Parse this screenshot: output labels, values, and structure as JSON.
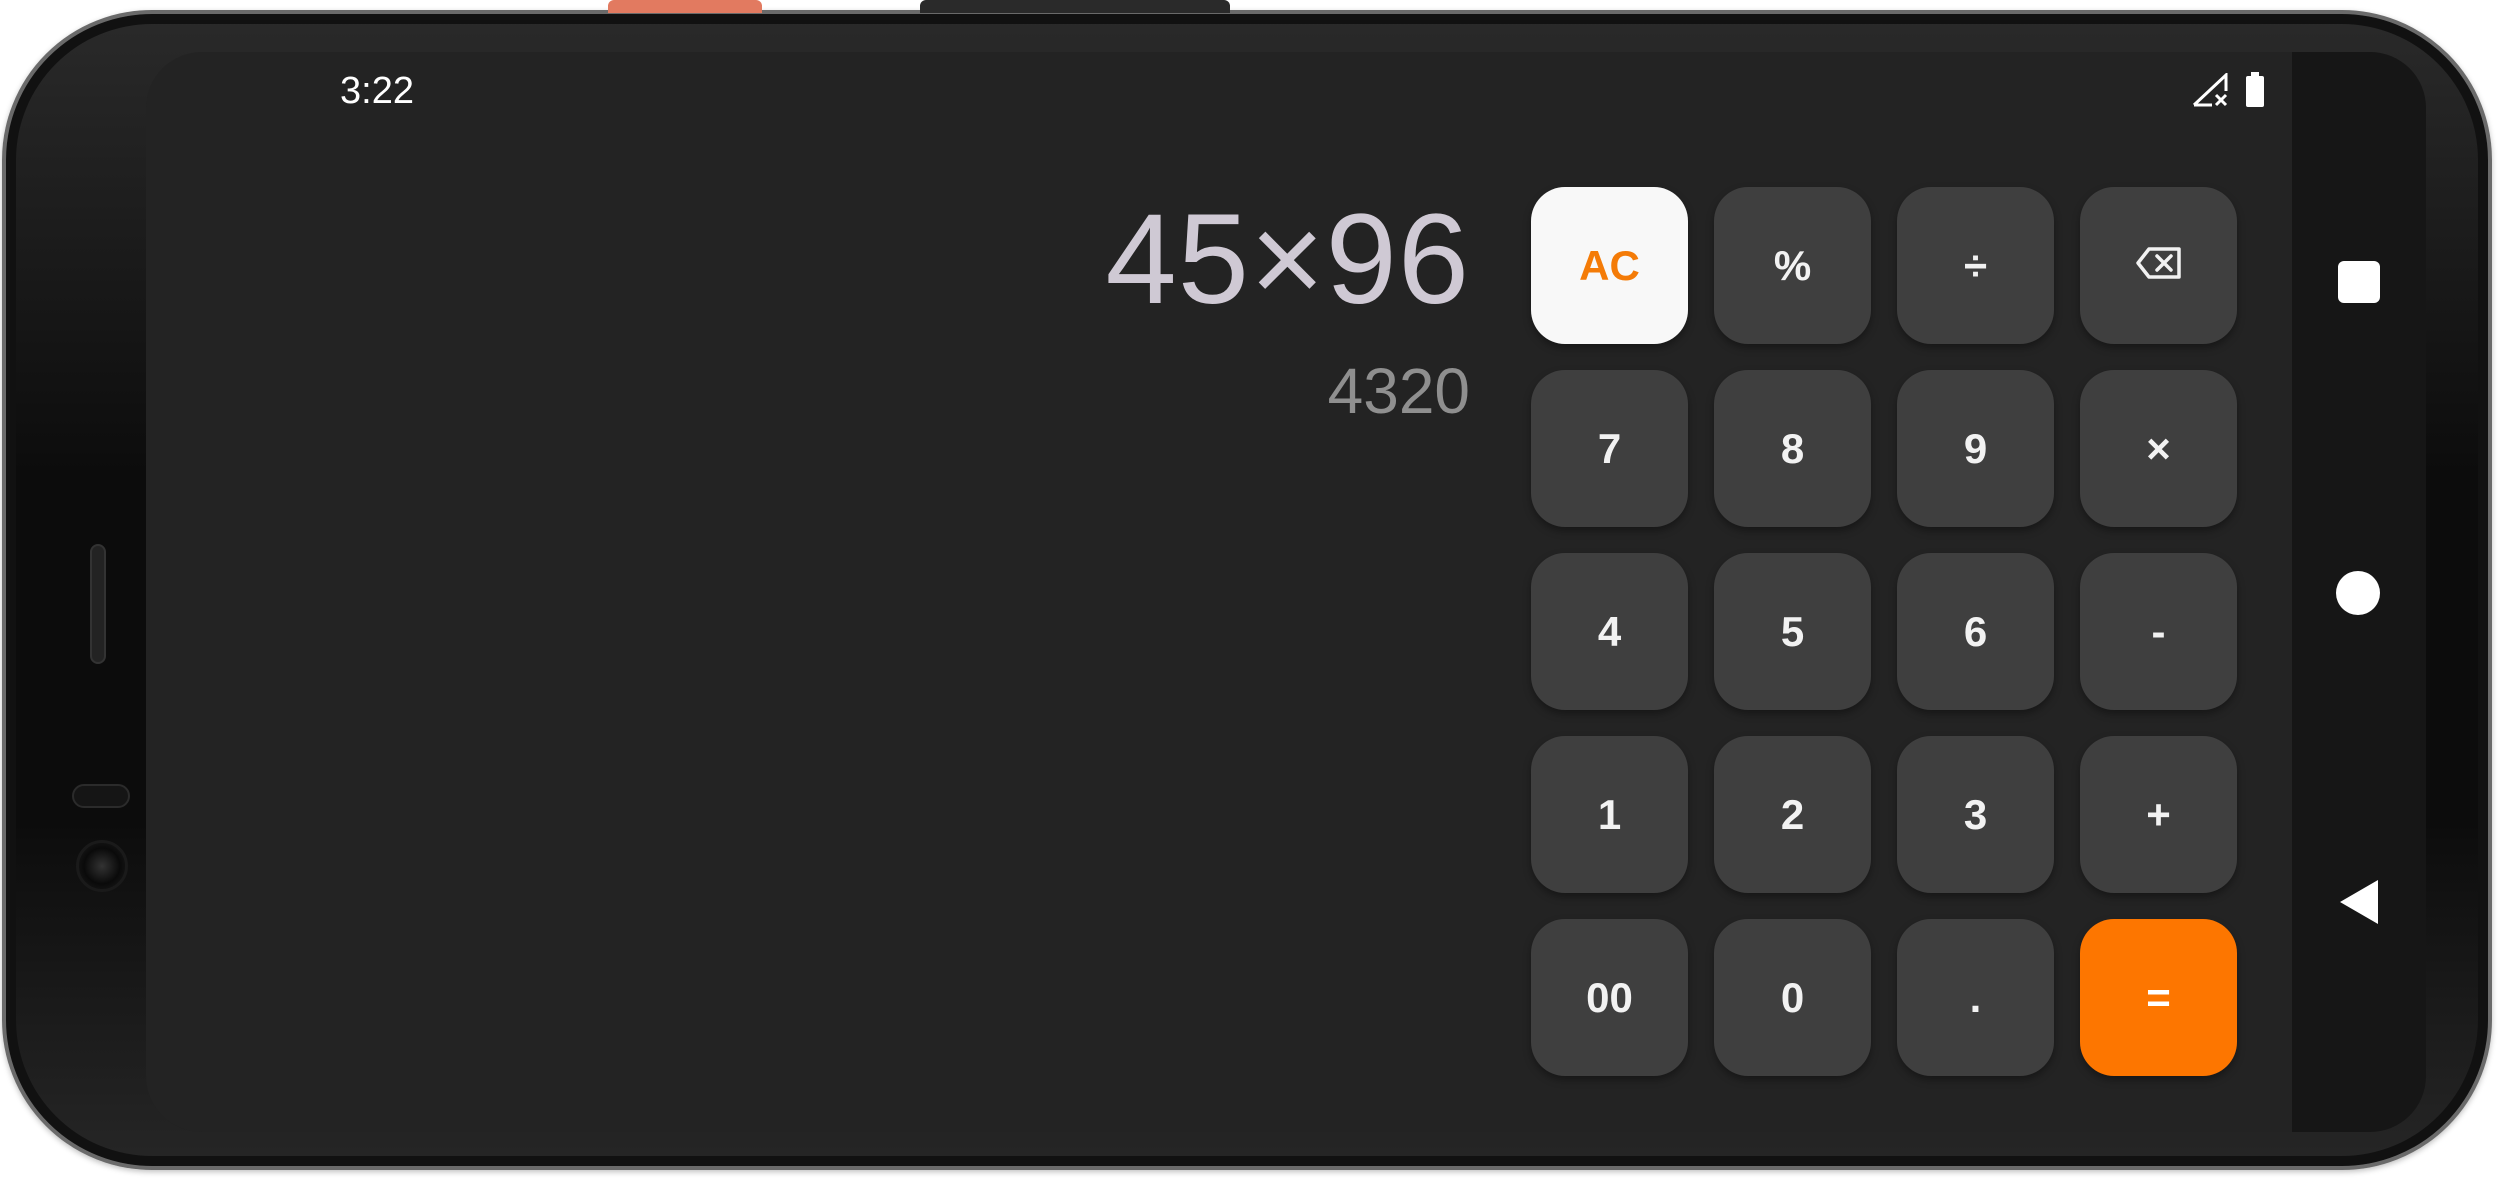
{
  "status_bar": {
    "time": "3:22",
    "icons": [
      "signal-no-service-icon",
      "battery-icon"
    ]
  },
  "display": {
    "expression": "45×96",
    "result": "4320"
  },
  "keypad": {
    "rows": [
      [
        "AC",
        "%",
        "÷",
        "backspace"
      ],
      [
        "7",
        "8",
        "9",
        "×"
      ],
      [
        "4",
        "5",
        "6",
        "-"
      ],
      [
        "1",
        "2",
        "3",
        "+"
      ],
      [
        "00",
        "0",
        ".",
        "="
      ]
    ],
    "ac": "AC",
    "percent": "%",
    "divide": "÷",
    "backspace_icon": "backspace-icon",
    "seven": "7",
    "eight": "8",
    "nine": "9",
    "multiply": "×",
    "four": "4",
    "five": "5",
    "six": "6",
    "minus": "-",
    "one": "1",
    "two": "2",
    "three": "3",
    "plus": "+",
    "double_zero": "00",
    "zero": "0",
    "decimal": ".",
    "equals": "="
  },
  "nav_bar": {
    "buttons": [
      "recents-icon",
      "home-icon",
      "back-icon"
    ]
  },
  "colors": {
    "screen_background": "#232323",
    "key_background": "#3f3f3f",
    "ac_background": "#f8f8f8",
    "accent_orange": "#fd7600",
    "expression_text": "#cfc9d4",
    "result_text": "#8f8f8f"
  }
}
